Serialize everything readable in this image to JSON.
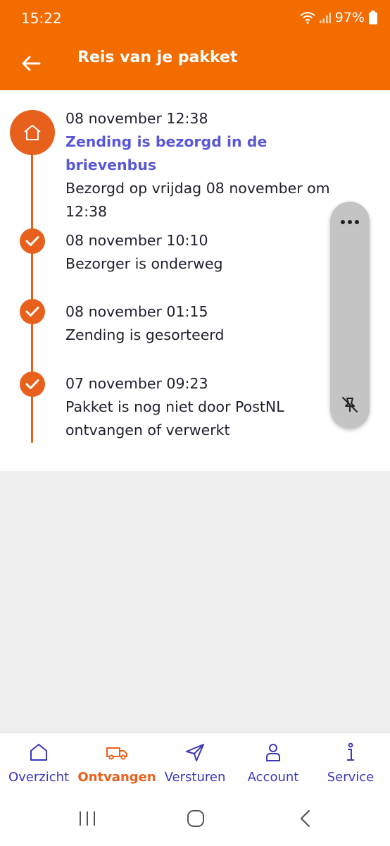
{
  "status_bar": {
    "time": "15:22",
    "battery": "97%",
    "icons": [
      "wifi-icon",
      "signal-icon",
      "battery-icon"
    ]
  },
  "app_bar": {
    "title": "Reis van je pakket",
    "back_icon": "arrow-left-icon"
  },
  "timeline": {
    "events": [
      {
        "datetime": "08 november 12:38",
        "title": "Zending is bezorgd in de brievenbus",
        "description": "Bezorgd op vrijdag 08 november om 12:38",
        "icon": "home-icon"
      },
      {
        "datetime": "08 november 10:10",
        "description": "Bezorger is onderweg",
        "icon": "check-icon"
      },
      {
        "datetime": "08 november 01:15",
        "description": "Zending is gesorteerd",
        "icon": "check-icon"
      },
      {
        "datetime": "07 november 09:23",
        "description": "Pakket is nog niet door PostNL ontvangen of verwerkt",
        "icon": "check-icon"
      }
    ]
  },
  "floating_pill": {
    "top_icon": "more-horizontal-icon",
    "bottom_icon": "unpin-icon"
  },
  "bottom_nav": {
    "items": [
      {
        "label": "Overzicht",
        "icon": "home-outline-icon",
        "active": false
      },
      {
        "label": "Ontvangen",
        "icon": "delivery-truck-icon",
        "active": true
      },
      {
        "label": "Versturen",
        "icon": "send-icon",
        "active": false
      },
      {
        "label": "Account",
        "icon": "person-icon",
        "active": false
      },
      {
        "label": "Service",
        "icon": "info-icon",
        "active": false
      }
    ]
  },
  "colors": {
    "brand_orange": "#f26c00",
    "timeline_orange": "#e7601c",
    "link_purple": "#5a57d6",
    "nav_blue": "#3b38b8"
  }
}
